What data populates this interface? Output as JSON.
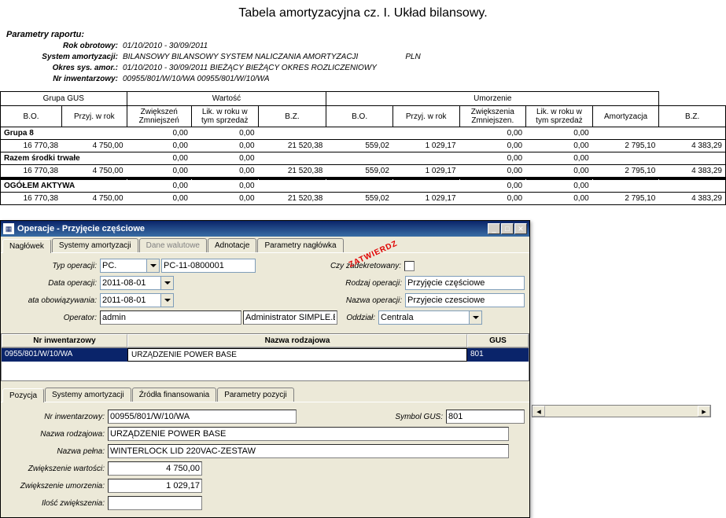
{
  "report": {
    "title": "Tabela amortyzacyjna cz. I. Układ bilansowy.",
    "params_heading": "Parametry raportu:",
    "params": {
      "rok_obrotowy_label": "Rok obrotowy:",
      "rok_obrotowy": "01/10/2010 - 30/09/2011",
      "system_amortyzacji_label": "System amortyzacji:",
      "system_amortyzacji": "BILANSOWY  BILANSOWY SYSTEM NALICZANIA AMORTYZACJI",
      "currency": "PLN",
      "okres_sys_amor_label": "Okres sys. amor.:",
      "okres_sys_amor": "01/10/2010 - 30/09/2011   BIEŻĄCY BIEŻĄCY OKRES ROZLICZENIOWY",
      "nr_inwentarzowy_label": "Nr inwentarzowy:",
      "nr_inwentarzowy": "00955/801/W/10/WA        00955/801/W/10/WA"
    },
    "headers": {
      "grupa_gus": "Grupa GUS",
      "wartosc": "Wartość",
      "umorzenie": "Umorzenie",
      "bo": "B.O.",
      "przyj_w_rok": "Przyj. w rok",
      "zwiekszen_zmniejszen": "Zwiększeń Zmniejszeń",
      "lik_w_roku": "Lik. w roku w tym sprzedaż",
      "bz": "B.Z.",
      "zwiekszenia_zmniejszen": "Zwiększenia Zmniejszen.",
      "amortyzacja": "Amortyzacja"
    },
    "rows": {
      "grupa8_label": "Grupa 8",
      "grupa8": {
        "bo": "16 770,38",
        "przyj": "4 750,00",
        "zw1": "0,00",
        "zw2": "0,00",
        "lik1": "0,00",
        "lik2": "0,00",
        "bz": "21 520,38",
        "u_bo": "559,02",
        "u_przyj": "1 029,17",
        "u_zw1": "0,00",
        "u_zw2": "0,00",
        "u_lik1": "0,00",
        "u_lik2": "0,00",
        "amort": "2 795,10",
        "u_bz": "4 383,29"
      },
      "razem_label": "Razem środki trwałe",
      "razem": {
        "bo": "16 770,38",
        "przyj": "4 750,00",
        "zw1": "0,00",
        "zw2": "0,00",
        "lik1": "0,00",
        "lik2": "0,00",
        "bz": "21 520,38",
        "u_bo": "559,02",
        "u_przyj": "1 029,17",
        "u_zw1": "0,00",
        "u_zw2": "0,00",
        "u_lik1": "0,00",
        "u_lik2": "0,00",
        "amort": "2 795,10",
        "u_bz": "4 383,29"
      },
      "ogolem_label": "OGÓŁEM AKTYWA",
      "ogolem": {
        "bo": "16 770,38",
        "przyj": "4 750,00",
        "zw1": "0,00",
        "zw2": "0,00",
        "lik1": "0,00",
        "lik2": "0,00",
        "bz": "21 520,38",
        "u_bo": "559,02",
        "u_przyj": "1 029,17",
        "u_zw1": "0,00",
        "u_zw2": "0,00",
        "u_lik1": "0,00",
        "u_lik2": "0,00",
        "amort": "2 795,10",
        "u_bz": "4 383,29"
      }
    }
  },
  "dialog": {
    "title": "Operacje - Przyjęcie częściowe",
    "tabs1": {
      "naglowek": "Nagłówek",
      "systemy": "Systemy amortyzacji",
      "dane_walutowe": "Dane walutowe",
      "adnotacje": "Adnotacje",
      "parametry": "Parametry nagłówka"
    },
    "stamp": "ZATWIERDZ",
    "header_form": {
      "typ_operacji_label": "Typ operacji:",
      "typ_operacji": "PC.",
      "typ_operacji_num": "PC-11-0800001",
      "czy_zadekretowany_label": "Czy zadekretowany:",
      "data_operacji_label": "Data operacji:",
      "data_operacji": "2011-08-01",
      "rodzaj_operacji_label": "Rodzaj operacji:",
      "rodzaj_operacji": "Przyjęcie częściowe",
      "data_obow_label": "ata obowiązywania:",
      "data_obow": "2011-08-01",
      "nazwa_operacji_label": "Nazwa operacji:",
      "nazwa_operacji": "Przyjecie czesciowe",
      "operator_label": "Operator:",
      "operator": "admin",
      "operator_desc": "Administrator SIMPLE.E",
      "oddzial_label": "Oddział:",
      "oddzial": "Centrala"
    },
    "grid": {
      "col_nr": "Nr inwentarzowy",
      "col_nazwa": "Nazwa rodzajowa",
      "col_gus": "GUS",
      "row_nr": "0955/801/W/10/WA",
      "row_nazwa": "URZĄDZENIE POWER BASE",
      "row_gus": "801"
    },
    "tabs2": {
      "pozycja": "Pozycja",
      "systemy": "Systemy amortyzacji",
      "zrodla": "Źródła finansowania",
      "parametry": "Parametry pozycji"
    },
    "detail_form": {
      "nr_inw_label": "Nr inwentarzowy:",
      "nr_inw": "00955/801/W/10/WA",
      "symbol_gus_label": "Symbol GUS:",
      "symbol_gus": "801",
      "nazwa_rodz_label": "Nazwa rodzajowa:",
      "nazwa_rodz": "URZĄDZENIE POWER BASE",
      "nazwa_pelna_label": "Nazwa pełna:",
      "nazwa_pelna": "WINTERLOCK LID 220VAC-ZESTAW",
      "zwiek_wart_label": "Zwiększenie wartości:",
      "zwiek_wart": "4 750,00",
      "zwiek_umorz_label": "Zwiększenie umorzenia:",
      "zwiek_umorz": "1 029,17",
      "ilosc_label": "Ilość zwiększenia:"
    }
  }
}
